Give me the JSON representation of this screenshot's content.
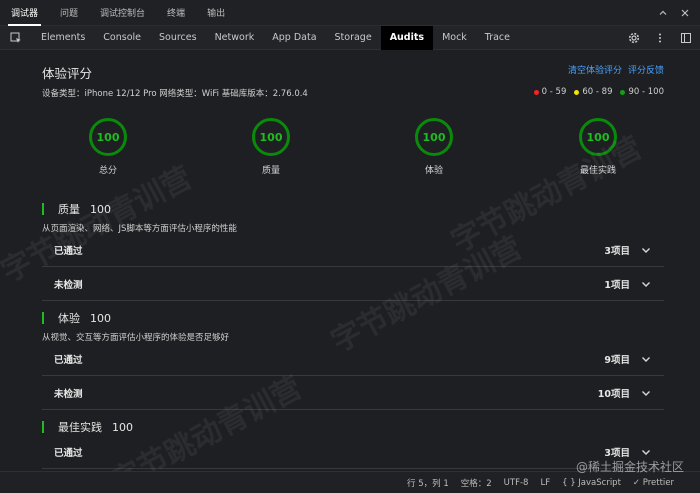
{
  "top_tabs": [
    {
      "label": "调试器",
      "active": true
    },
    {
      "label": "问题",
      "active": false
    },
    {
      "label": "调试控制台",
      "active": false
    },
    {
      "label": "终端",
      "active": false
    },
    {
      "label": "输出",
      "active": false
    }
  ],
  "devtools_tabs": [
    {
      "label": "Elements",
      "active": false
    },
    {
      "label": "Console",
      "active": false
    },
    {
      "label": "Sources",
      "active": false
    },
    {
      "label": "Network",
      "active": false
    },
    {
      "label": "App Data",
      "active": false
    },
    {
      "label": "Storage",
      "active": false
    },
    {
      "label": "Audits",
      "active": true
    },
    {
      "label": "Mock",
      "active": false
    },
    {
      "label": "Trace",
      "active": false
    }
  ],
  "header": {
    "title": "体验评分",
    "clear_link": "清空体验评分",
    "feedback_link": "评分反馈",
    "meta": "设备类型：iPhone 12/12 Pro 网络类型：WiFi 基础库版本：2.76.0.4",
    "legend": [
      {
        "label": "0 - 59",
        "color": "#ff2020"
      },
      {
        "label": "60 - 89",
        "color": "#f5e400"
      },
      {
        "label": "90 - 100",
        "color": "#14a014"
      }
    ]
  },
  "gauges": [
    {
      "score": "100",
      "label": "总分"
    },
    {
      "score": "100",
      "label": "质量"
    },
    {
      "score": "100",
      "label": "体验"
    },
    {
      "score": "100",
      "label": "最佳实践"
    }
  ],
  "sections": [
    {
      "title": "质量",
      "score": "100",
      "desc": "从页面渲染、网络、JS脚本等方面评估小程序的性能",
      "rows": [
        {
          "label": "已通过",
          "count": "3项目"
        },
        {
          "label": "未检测",
          "count": "1项目"
        }
      ]
    },
    {
      "title": "体验",
      "score": "100",
      "desc": "从视觉、交互等方面评估小程序的体验是否足够好",
      "rows": [
        {
          "label": "已通过",
          "count": "9项目"
        },
        {
          "label": "未检测",
          "count": "10项目"
        }
      ]
    },
    {
      "title": "最佳实践",
      "score": "100",
      "desc": "",
      "rows": [
        {
          "label": "已通过",
          "count": "3项目"
        }
      ]
    }
  ],
  "statusbar": {
    "position": "行 5，列 1",
    "spaces": "空格：2",
    "encoding": "UTF-8",
    "eol": "LF",
    "language": "{ } JavaScript",
    "formatter": "✓ Prettier"
  },
  "watermark": {
    "text": "字节跳动青训营",
    "site": "@稀土掘金技术社区"
  },
  "colors": {
    "accent_green": "#1fbd1f",
    "link_blue": "#4aa3ff",
    "background": "#1e1f22"
  }
}
